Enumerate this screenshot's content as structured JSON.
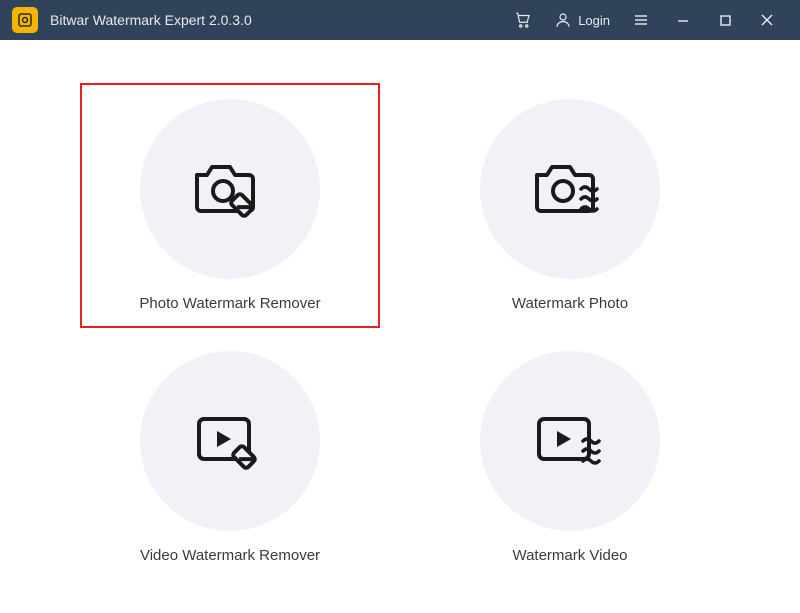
{
  "header": {
    "title": "Bitwar Watermark Expert  2.0.3.0",
    "login_label": "Login"
  },
  "options": [
    {
      "label": "Photo Watermark Remover",
      "highlighted": true
    },
    {
      "label": "Watermark Photo",
      "highlighted": false
    },
    {
      "label": "Video Watermark Remover",
      "highlighted": false
    },
    {
      "label": "Watermark Video",
      "highlighted": false
    }
  ]
}
